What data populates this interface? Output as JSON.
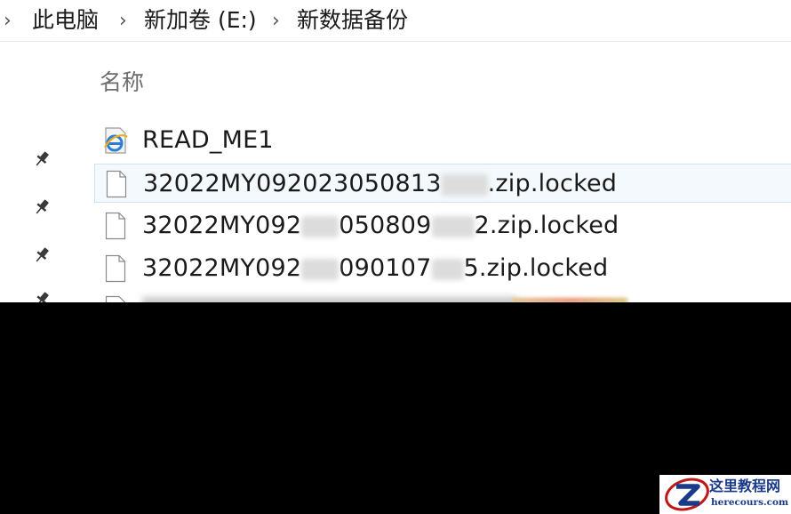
{
  "breadcrumb": {
    "items": [
      "此电脑",
      "新加卷 (E:)",
      "新数据备份"
    ]
  },
  "file_list": {
    "column_header": "名称",
    "rows": [
      {
        "name": "READ_ME1",
        "icon": "ie-document-icon"
      },
      {
        "name_start": "32022MY092023050813",
        "name_end": ".zip.locked",
        "icon": "file-icon"
      },
      {
        "name_start": "32022MY092",
        "name_mid": "050809",
        "name_end": "2.zip.locked",
        "icon": "file-icon"
      },
      {
        "name_start": "32022MY092",
        "name_mid": "090107",
        "name_end": "5.zip.locked",
        "icon": "file-icon"
      }
    ]
  },
  "watermark": {
    "title": "这里教程网",
    "url": "herecours.com"
  },
  "colors": {
    "selection_bg": "#f4f9fd",
    "selection_border": "#cce4f7",
    "watermark_blue": "#1a3a8a"
  }
}
